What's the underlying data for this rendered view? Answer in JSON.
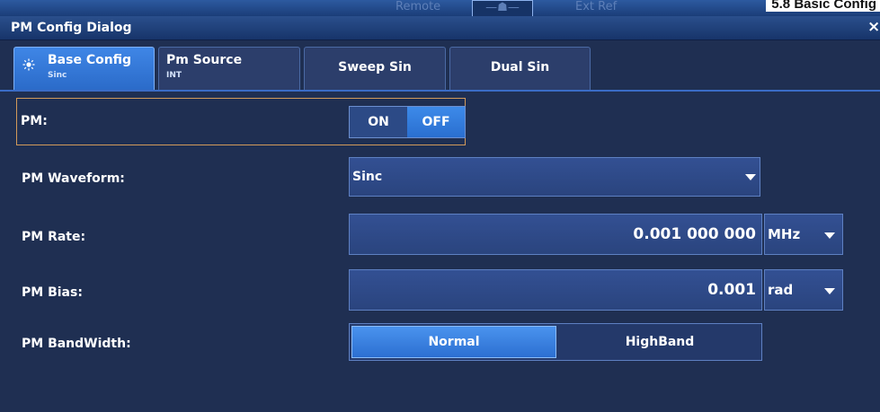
{
  "background_strip": {
    "remote_label": "Remote",
    "home_label": "—☗—",
    "ext_ref_label": "Ext Ref",
    "right_heading": "5.8 Basic Config"
  },
  "dialog": {
    "title": "PM Config Dialog",
    "close_symbol": "×"
  },
  "tabs": [
    {
      "label": "Base Config",
      "sub": "Sinc",
      "active": true
    },
    {
      "label": "Pm Source",
      "sub": "INT",
      "active": false
    },
    {
      "label": "Sweep Sin",
      "sub": "",
      "active": false
    },
    {
      "label": "Dual Sin",
      "sub": "",
      "active": false
    }
  ],
  "pm": {
    "label": "PM:",
    "on_label": "ON",
    "off_label": "OFF",
    "selected": "OFF"
  },
  "waveform": {
    "label": "PM Waveform:",
    "value": "Sinc"
  },
  "rate": {
    "label": "PM Rate:",
    "value": "0.001 000 000",
    "unit": "MHz"
  },
  "bias": {
    "label": "PM Bias:",
    "value": "0.001",
    "unit": "rad"
  },
  "bandwidth": {
    "label": "PM BandWidth:",
    "options": [
      "Normal",
      "HighBand"
    ],
    "selected": "Normal"
  },
  "colors": {
    "dialog_bg": "#1f2f52",
    "accent": "#3d8ae9",
    "field_bg": "#2f4a88",
    "highlight_border": "#d29a5a"
  },
  "icons": {
    "tab_active": "sun-icon",
    "dropdown": "caret-down-icon",
    "close": "close-icon"
  }
}
